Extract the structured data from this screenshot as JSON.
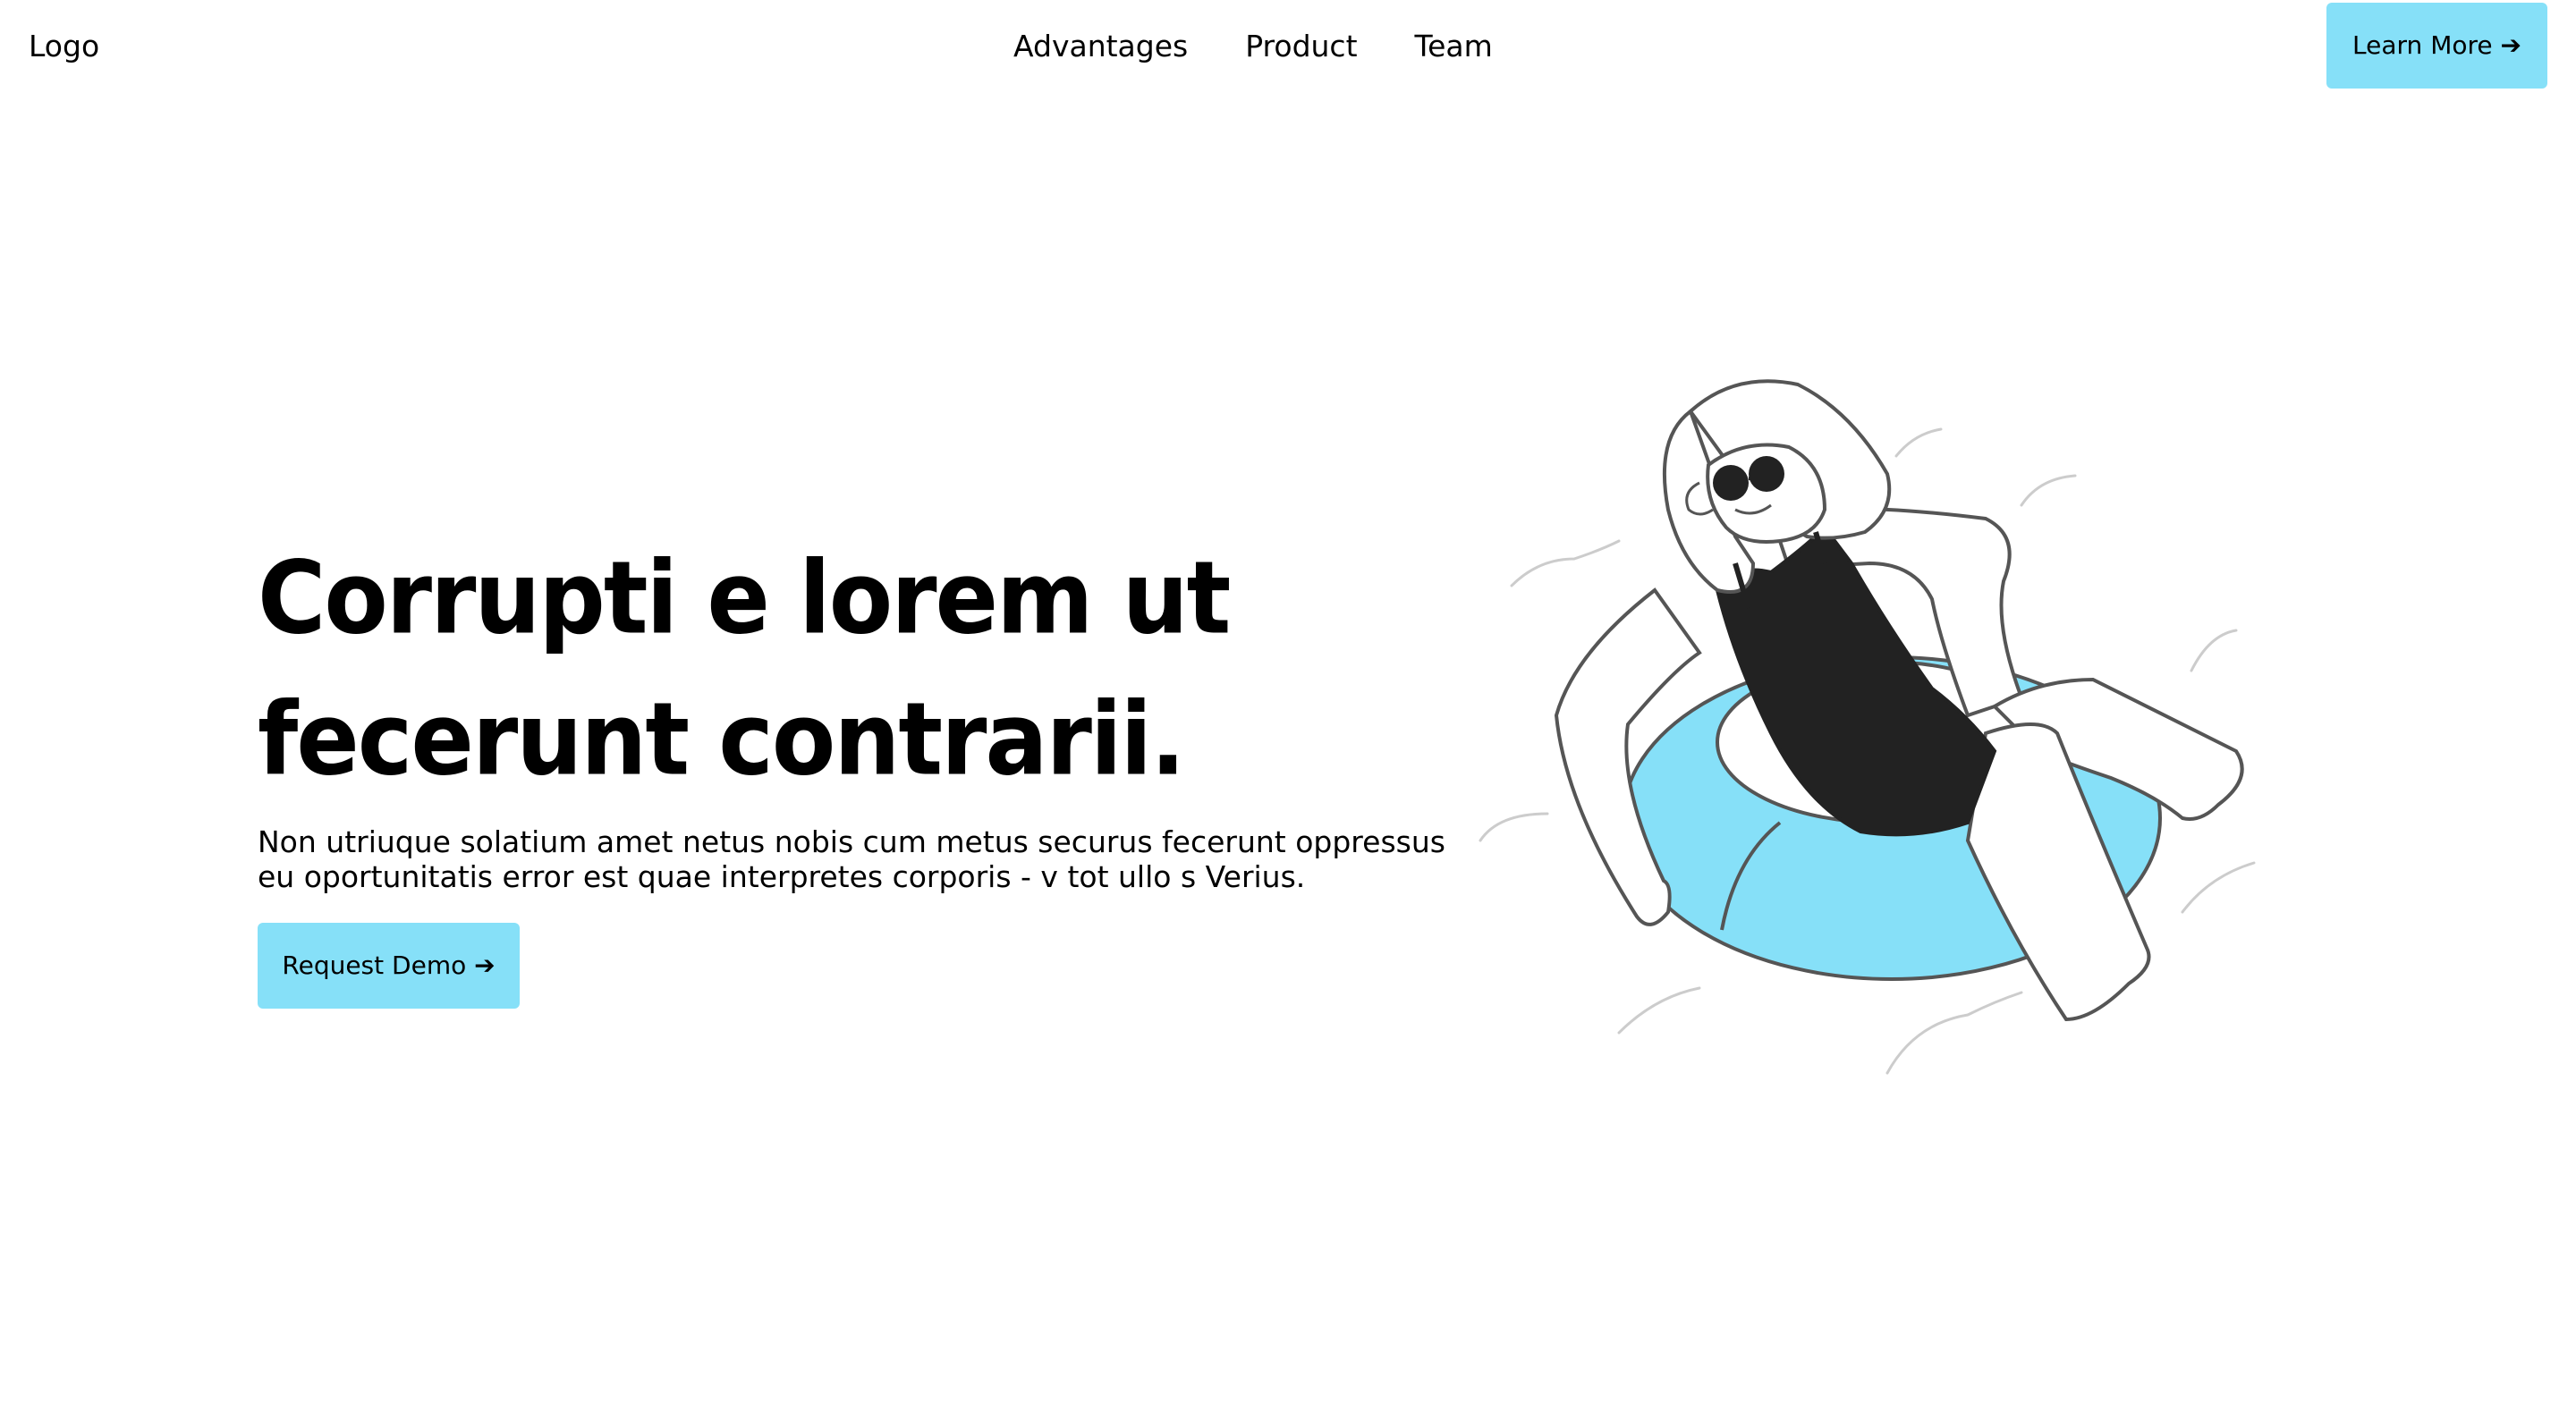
{
  "nav": {
    "logo": "Logo",
    "links": [
      "Advantages",
      "Product",
      "Team"
    ],
    "cta": "Learn More ➔"
  },
  "hero": {
    "title": "Corrupti e lorem ut fecerunt contrarii.",
    "subtitle": "Non utriuque solatium amet netus nobis cum metus securus fecerunt oppressus eu oportunitatis error est quae interpretes corporis - v tot ullo s Verius.",
    "cta": "Request Demo ➔"
  },
  "colors": {
    "accent": "#86e0f8",
    "ink": "#000000",
    "swimsuit": "#222222",
    "background": "#ffffff"
  },
  "illustration": {
    "icon": "woman-floating-on-swim-ring-illustration"
  }
}
